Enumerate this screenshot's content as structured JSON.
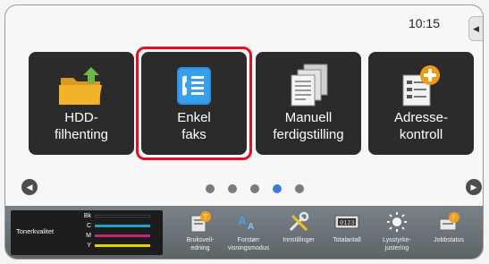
{
  "header": {
    "clock": "10:15"
  },
  "tiles": [
    {
      "line1": "HDD-",
      "line2": "filhenting"
    },
    {
      "line1": "Enkel",
      "line2": "faks"
    },
    {
      "line1": "Manuell",
      "line2": "ferdigstilling"
    },
    {
      "line1": "Adresse-",
      "line2": "kontroll"
    }
  ],
  "pager": {
    "page_count": 5,
    "current_page": 4
  },
  "toner": {
    "label": "Tonerkvalitet",
    "rows": [
      {
        "key": "Bk",
        "color": "#000000"
      },
      {
        "key": "C",
        "color": "#1aa3c8"
      },
      {
        "key": "M",
        "color": "#c2267a"
      },
      {
        "key": "Y",
        "color": "#e6d200"
      }
    ]
  },
  "tools": [
    {
      "line1": "Bruksveil-",
      "line2": "edning"
    },
    {
      "line1": "Forstørr",
      "line2": "visningsmodus"
    },
    {
      "line1": "Innstillinger",
      "line2": ""
    },
    {
      "line1": "Totalantall",
      "line2": ""
    },
    {
      "line1": "Lysstyrke-",
      "line2": "justering"
    },
    {
      "line1": "Jobbstatus",
      "line2": ""
    }
  ],
  "icons": {
    "tiles": [
      "hdd-folder-icon",
      "fax-icon",
      "finishing-icon",
      "address-book-icon"
    ],
    "tools": [
      "guide-book-icon",
      "magnify-text-icon",
      "settings-tools-icon",
      "counter-icon",
      "brightness-icon",
      "job-status-icon"
    ]
  },
  "colors": {
    "accent_red": "#e0102a",
    "tile_bg": "#2b2b2b",
    "active_dot": "#3c7ad6"
  }
}
